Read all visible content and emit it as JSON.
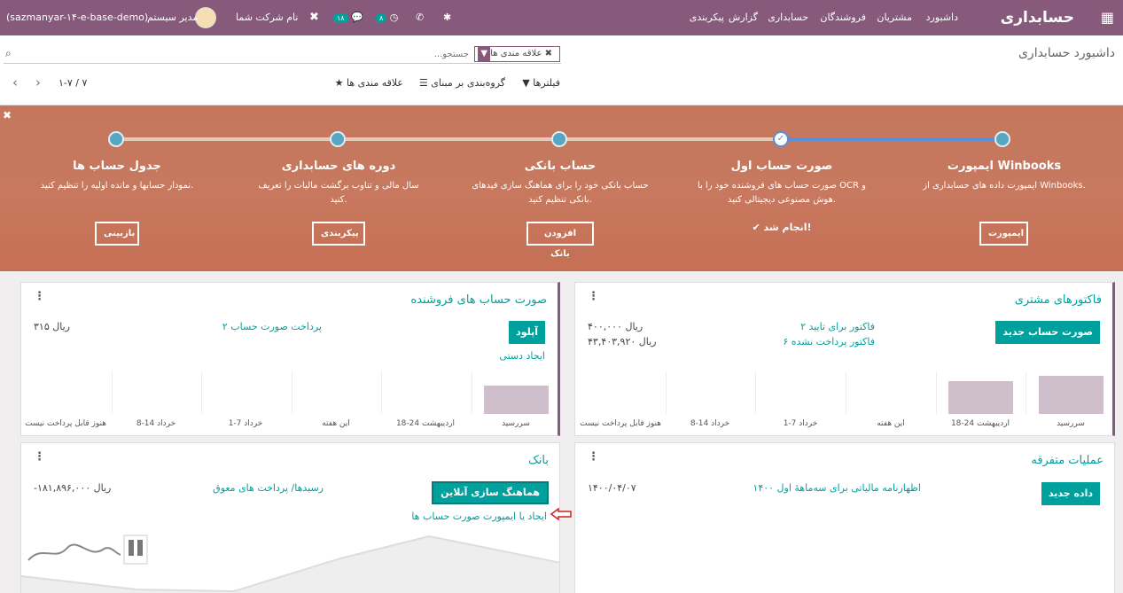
{
  "navbar": {
    "brand": "حسابداری",
    "menu": [
      "داشبورد",
      "مشتریان",
      "فروشندگان",
      "حسابداری",
      "گزارش",
      "پیکربندی"
    ],
    "company": "نام شرکت شما",
    "chat_count": "۱۸",
    "activity_count": "۸",
    "user": "مدیر سیستم",
    "database": "(sazmanyar-۱۴-e-base-demo)"
  },
  "cpanel": {
    "title": "داشبورد حسابداری",
    "facet": "علاقه مندی ها",
    "search_placeholder": "جستجو...",
    "filters": "فیلترها",
    "groupby": "گروه‌بندی بر مبنای",
    "favorites": "علاقه مندی ها",
    "pager": "۱-۷ / ۷"
  },
  "banner": {
    "steps": [
      {
        "title": "ایمپورت Winbooks",
        "desc": "ایمپورت داده های حسابداری از Winbooks.",
        "button": "ایمپورت"
      },
      {
        "title": "صورت حساب اول",
        "desc": "صورت حساب های فروشنده خود را با OCR و هوش مصنوعی دیجیتالی کنید.",
        "done": "انجام شد!"
      },
      {
        "title": "حساب بانکی",
        "desc": "حساب بانکی خود را برای هماهنگ سازی فیدهای بانکی تنظیم کنید.",
        "button": "افزودن بانک"
      },
      {
        "title": "دوره های حسابداری",
        "desc": "سال مالی و تناوب برگشت مالیات را تعریف کنید.",
        "button": "پیکربندی"
      },
      {
        "title": "جدول حساب ها",
        "desc": "نمودار حسابها و مانده اولیه را تنظیم کنید.",
        "button": "بازبینی"
      }
    ]
  },
  "cards": {
    "customer_invoices": {
      "title": "فاکتورهای مشتری",
      "button": "صورت حساب جدید",
      "lines": [
        {
          "label": "۲ فاکتور برای تایید",
          "amount": "۴۰۰,۰۰۰ ریال"
        },
        {
          "label": "۶ فاکتور پرداخت نشده",
          "amount": "۴۳,۴۰۳,۹۲۰ ریال"
        }
      ],
      "axis": [
        "سررسید",
        "18-24 اردیبهشت",
        "این هفته",
        "1-7 خرداد",
        "8-14 خرداد",
        "هنوز قابل پرداخت نیست"
      ]
    },
    "vendor_bills": {
      "title": "صورت حساب های فروشنده",
      "button": "آپلود",
      "manual": "ایجاد دستی",
      "line": {
        "label": "۲ پرداخت صورت حساب",
        "amount": "۳۱۵ ریال"
      },
      "axis": [
        "سررسید",
        "18-24 اردیبهشت",
        "این هفته",
        "1-7 خرداد",
        "8-14 خرداد",
        "هنوز قابل پرداخت نیست"
      ]
    },
    "misc": {
      "title": "عملیات متفرقه",
      "button": "داده جدید",
      "line": {
        "label": "اظهارنامه مالیاتی برای سه‌ماههٔ اول ۱۴۰۰",
        "date": "۱۴۰۰/۰۴/۰۷"
      }
    },
    "bank": {
      "title": "بانک",
      "button": "هماهنگ سازی آنلاین",
      "import_link": "ایجاد یا ایمپورت صورت حساب ها",
      "line": {
        "label": "رسیدها/ پرداخت های معوق",
        "amount": "-۱۸۱,۸۹۶,۰۰۰ ریال"
      }
    }
  },
  "chart_data": [
    {
      "type": "bar",
      "categories": [
        "سررسید",
        "18-24 اردیبهشت",
        "این هفته",
        "1-7 خرداد",
        "8-14 خرداد",
        "هنوز قابل پرداخت نیست"
      ],
      "values": [
        43,
        37,
        0,
        0,
        0,
        0
      ]
    },
    {
      "type": "bar",
      "categories": [
        "سررسید",
        "18-24 اردیبهشت",
        "این هفته",
        "1-7 خرداد",
        "8-14 خرداد",
        "هنوز قابل پرداخت نیست"
      ],
      "values": [
        32,
        0,
        0,
        0,
        0,
        0
      ]
    }
  ],
  "colors": {
    "primary": "#875a7b",
    "accent": "#00a09d",
    "banner": "#c4775c",
    "bar": "#cfbecb",
    "arrow": "#cc2222"
  },
  "icons": [
    "apps-grid-icon",
    "bug-icon",
    "phone-icon",
    "clock-icon",
    "chat-icon",
    "tools-icon",
    "filter-icon",
    "search-icon",
    "star-icon",
    "list-icon",
    "chevron-left-icon",
    "chevron-right-icon",
    "close-icon",
    "check-icon",
    "kebab-icon",
    "arrow-left-icon"
  ]
}
